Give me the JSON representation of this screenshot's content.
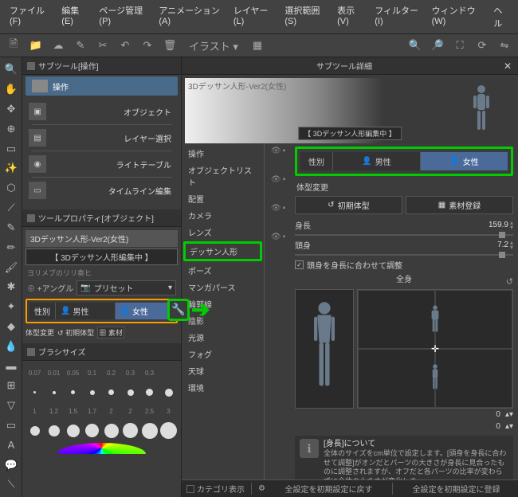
{
  "menu": {
    "file": "ファイル(F)",
    "edit": "編集(E)",
    "page": "ページ管理(P)",
    "anim": "アニメーション(A)",
    "layer": "レイヤー(L)",
    "select": "選択範囲(S)",
    "view": "表示(V)",
    "filter": "フィルター(I)",
    "window": "ウィンドウ(W)",
    "help": "ヘル"
  },
  "iconbar": {
    "docsel": "イラスト ▾"
  },
  "panels": {
    "subtool_head": "サブツール[操作]",
    "toolprop_head": "ツールプロパティ[オブジェクト]",
    "brushsize_head": "ブラシサイズ"
  },
  "subtool": {
    "main": "操作",
    "items": [
      "オブジェクト",
      "レイヤー選択",
      "ライトテーブル",
      "タイムライン編集"
    ]
  },
  "toolprop": {
    "title": "3Dデッサン人形-Ver2(女性)",
    "editing": "【 3Dデッサン人形編集中 】",
    "snip": "ヨリメブのリリ奏ヒ",
    "angle_lbl": "+アングル",
    "preset_lbl": "プリセット",
    "gender_lbl": "性別",
    "male": "男性",
    "female": "女性",
    "body_lbl": "体型変更",
    "reset_lbl": "初期体型",
    "save_lbl": "素材"
  },
  "brush": {
    "labels": [
      "0.07",
      "0.01",
      "0.05",
      "0.1",
      "0.2",
      "0.3",
      "0.3"
    ],
    "row2": [
      "1",
      "1.2",
      "1.5",
      "1.7",
      "2",
      "2",
      "2.5",
      "3"
    ]
  },
  "detail": {
    "title": "サブツール詳細",
    "preview_txt": "3Dデッサン人形-Ver2(女性)",
    "preview_badge": "【 3Dデッサン人形編集中 】",
    "cats": [
      "操作",
      "オブジェクトリスト",
      "配置",
      "カメラ",
      "レンズ",
      "デッサン人形",
      "ポーズ",
      "マンガパース",
      "輪郭線",
      "陰影",
      "光源",
      "フォグ",
      "天球",
      "環境"
    ],
    "gender_lbl": "性別",
    "male": "男性",
    "female": "女性",
    "body_change": "体型変更",
    "reset_btn": "初期体型",
    "save_btn": "素材登録",
    "height_lbl": "身長",
    "height_val": "159.9",
    "heads_lbl": "頭身",
    "heads_val": "7.2",
    "fit_chk": "頭身を身長に合わせて調整",
    "fullbody": "全身",
    "spin0a": "0",
    "spin0b": "0",
    "info_title": "[身長]について",
    "info_body": "全体のサイズをcm単位で設定します。[頭身を身長に合わせて調整]がオンだとパーツの大きさが身長に見合ったものに調整されますが、オフだと各パーツの比率が変わらずに全体の大きさが変化しま",
    "cat_show": "カテゴリ表示",
    "reset_all": "全設定を初期設定に戻す",
    "save_all": "全設定を初期設定に登録"
  }
}
